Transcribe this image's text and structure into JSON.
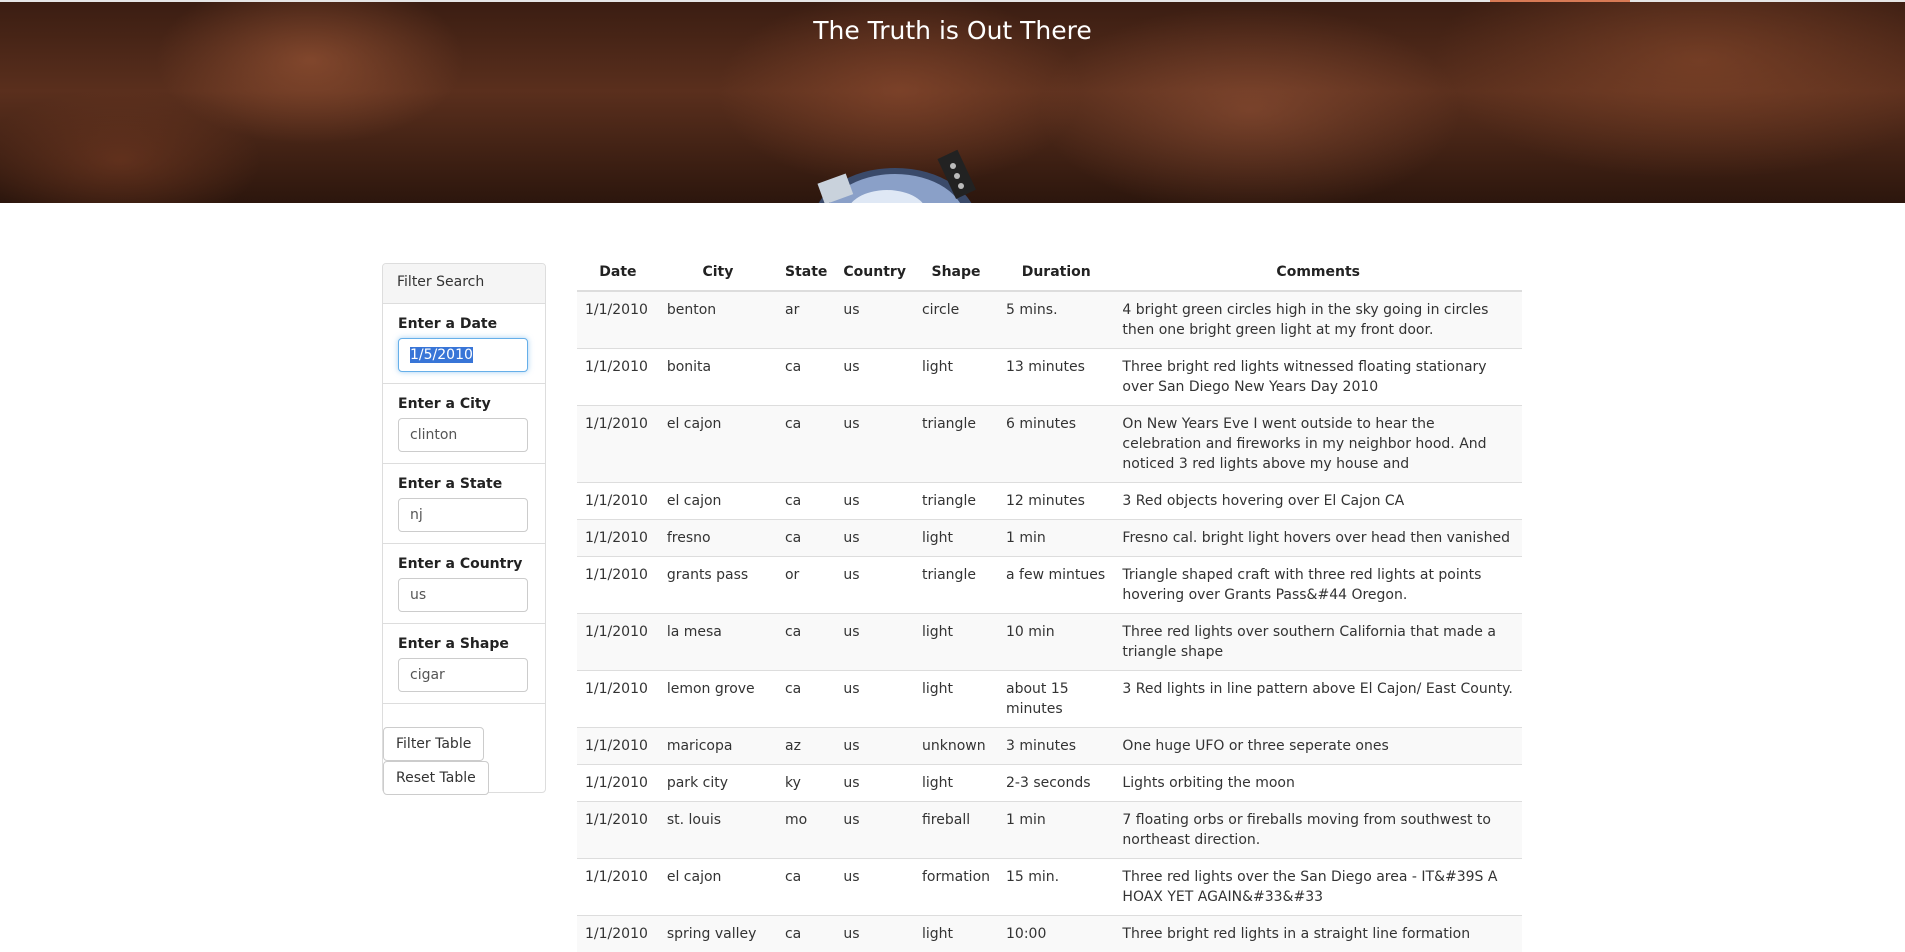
{
  "header": {
    "title": "The Truth is Out There"
  },
  "filters": {
    "heading": "Filter Search",
    "fields": [
      {
        "label": "Enter a Date",
        "value": "1/5/2010"
      },
      {
        "label": "Enter a City",
        "placeholder": "clinton"
      },
      {
        "label": "Enter a State",
        "placeholder": "nj"
      },
      {
        "label": "Enter a Country",
        "placeholder": "us"
      },
      {
        "label": "Enter a Shape",
        "placeholder": "cigar"
      }
    ],
    "filter_button": "Filter Table",
    "reset_button": "Reset Table"
  },
  "table": {
    "headers": [
      "Date",
      "City",
      "State",
      "Country",
      "Shape",
      "Duration",
      "Comments"
    ],
    "rows": [
      [
        "1/1/2010",
        "benton",
        "ar",
        "us",
        "circle",
        "5 mins.",
        "4 bright green circles high in the sky going in circles then one bright green light at my front door."
      ],
      [
        "1/1/2010",
        "bonita",
        "ca",
        "us",
        "light",
        "13 minutes",
        "Three bright red lights witnessed floating stationary over San Diego New Years Day 2010"
      ],
      [
        "1/1/2010",
        "el cajon",
        "ca",
        "us",
        "triangle",
        "6 minutes",
        "On New Years Eve I went outside to hear the celebration and fireworks in my neighbor hood. And noticed 3 red lights above my house and"
      ],
      [
        "1/1/2010",
        "el cajon",
        "ca",
        "us",
        "triangle",
        "12 minutes",
        "3 Red objects hovering over El Cajon CA"
      ],
      [
        "1/1/2010",
        "fresno",
        "ca",
        "us",
        "light",
        "1 min",
        "Fresno cal. bright light hovers over head then vanished"
      ],
      [
        "1/1/2010",
        "grants pass",
        "or",
        "us",
        "triangle",
        "a few mintues",
        "Triangle shaped craft with three red lights at points hovering over Grants Pass&#44 Oregon."
      ],
      [
        "1/1/2010",
        "la mesa",
        "ca",
        "us",
        "light",
        "10 min",
        "Three red lights over southern California that made a triangle shape"
      ],
      [
        "1/1/2010",
        "lemon grove",
        "ca",
        "us",
        "light",
        "about 15 minutes",
        "3 Red lights in line pattern above El Cajon/ East County."
      ],
      [
        "1/1/2010",
        "maricopa",
        "az",
        "us",
        "unknown",
        "3 minutes",
        "One huge UFO or three seperate ones"
      ],
      [
        "1/1/2010",
        "park city",
        "ky",
        "us",
        "light",
        "2-3 seconds",
        "Lights orbiting the moon"
      ],
      [
        "1/1/2010",
        "st. louis",
        "mo",
        "us",
        "fireball",
        "1 min",
        "7 floating orbs or fireballs moving from southwest to northeast direction."
      ],
      [
        "1/1/2010",
        "el cajon",
        "ca",
        "us",
        "formation",
        "15 min.",
        "Three red lights over the San Diego area - IT&#39S A HOAX YET AGAIN&#33&#33"
      ],
      [
        "1/1/2010",
        "spring valley",
        "ca",
        "us",
        "light",
        "10:00",
        "Three bright red lights in a straight line formation"
      ]
    ]
  },
  "colors": {
    "hero_dark": "#3a1d12",
    "hero_title": "#ffffff",
    "focus_border": "#66afe9",
    "selection": "#3875d7",
    "striped_row": "#f9f9f9",
    "border": "#dddddd"
  }
}
